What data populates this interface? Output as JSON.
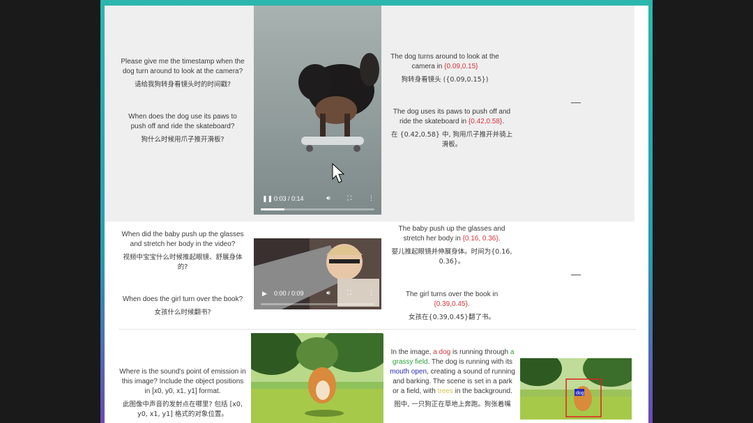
{
  "rows": [
    {
      "questions": [
        {
          "en": "Please give me the timestamp when the dog turn around to look at the camera?",
          "zh": "请给我狗转身看镜头时的时间戳?"
        },
        {
          "en": "When does the dog use its paws to push off and ride the skateboard?",
          "zh": "狗什么时候用爪子推开滑板?"
        }
      ],
      "video": {
        "time": "0:03 / 0:14",
        "progress": 0.21
      },
      "answers": [
        {
          "en_pre": "The dog turns around to look at the camera in ",
          "en_hl": "{0.09,0.15}",
          "en_post": "",
          "zh": "狗转身看镜头 ({0.09,0.15})"
        },
        {
          "en_pre": "The dog uses its paws to push off and ride the skateboard in ",
          "en_hl": "{0.42,0.58}",
          "en_post": ".",
          "zh": "在 {0.42,0.58} 中, 狗用爪子推开并骑上滑板。"
        }
      ],
      "extra": "—"
    },
    {
      "questions": [
        {
          "en": "When did the baby push up the glasses and stretch her body in the video?",
          "zh": "视频中宝宝什么时候推起眼镜、舒展身体的?"
        },
        {
          "en": "When does the girl turn over the book?",
          "zh": "女孩什么时候翻书?"
        }
      ],
      "video": {
        "time": "0:00 / 0:09",
        "progress": 0.0
      },
      "answers": [
        {
          "en_pre": "The baby push up the glasses and stretch her body in ",
          "en_hl": "{0.16, 0.36}",
          "en_post": ".",
          "zh": "婴儿推起眼镜并伸展身体。时间为{0.16, 0.36}。"
        },
        {
          "en_pre": "The girl turns over the book in ",
          "en_hl": "{0.39,0.45}",
          "en_post": ".",
          "zh": "女孩在{0.39,0.45}翻了书。"
        }
      ],
      "extra": "—"
    },
    {
      "question": {
        "en": "Where is the sound's point of emission in this image? Include the object positions in [x0, y0, x1, y1] format.",
        "zh": "此图像中声音的发射点在哪里? 包括 [x0, y0, x1, y1] 格式的对象位置。"
      },
      "answer": {
        "p1": "In the image, ",
        "h1": "a dog",
        "p2": " is running through ",
        "h2": "a grassy field",
        "p3": ". The dog is running with its ",
        "h3": "mouth open",
        "p4": ", creating a sound of running and barking. The scene is set in a park or a field, with ",
        "h4": "trees",
        "p5": " in the background.",
        "zh": "图中, 一只狗正在草地上奔跑。狗张着嘴"
      },
      "box_label": "dog"
    }
  ],
  "colors": {
    "highlight_red": "#d6333a",
    "highlight_green": "#2e9e3e",
    "highlight_blue": "#2a2ab8",
    "highlight_yellow": "#d9c54a"
  }
}
